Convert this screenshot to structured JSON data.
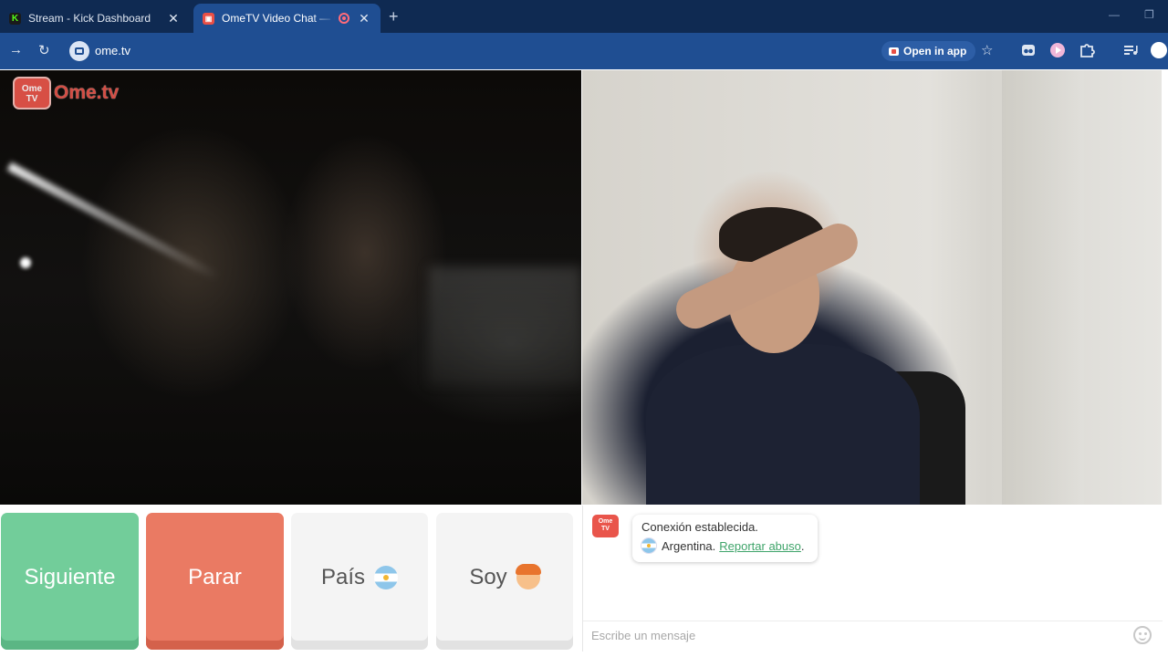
{
  "browser": {
    "tabs": [
      {
        "title": "Stream - Kick Dashboard",
        "favicon": "kick-icon",
        "active": false
      },
      {
        "title": "OmeTV Video Chat — Omegle",
        "favicon": "ometv-icon",
        "active": true,
        "recording": true
      }
    ],
    "new_tab_symbol": "+",
    "close_symbol": "✕",
    "url": "ome.tv",
    "open_in_app_label": "Open in app",
    "accent_color": "#1f4e92"
  },
  "stranger_video": {
    "watermark_badge": "Ome\nTV",
    "watermark_text": "Ome.tv"
  },
  "controls": {
    "next_label": "Siguiente",
    "stop_label": "Parar",
    "country_label": "País",
    "country_flag": "argentina-flag-icon",
    "gender_label": "Soy",
    "gender_icon": "boy-emoji-icon",
    "next_color": "#72cd9a",
    "stop_color": "#ea7a63"
  },
  "chat": {
    "logo_text": "Ome\nTV",
    "status_message": "Conexión establecida.",
    "country_name": "Argentina.",
    "report_link": "Reportar abuso",
    "report_suffix": ".",
    "input_placeholder": "Escribe un mensaje",
    "emoji_button": "smiley-icon"
  }
}
